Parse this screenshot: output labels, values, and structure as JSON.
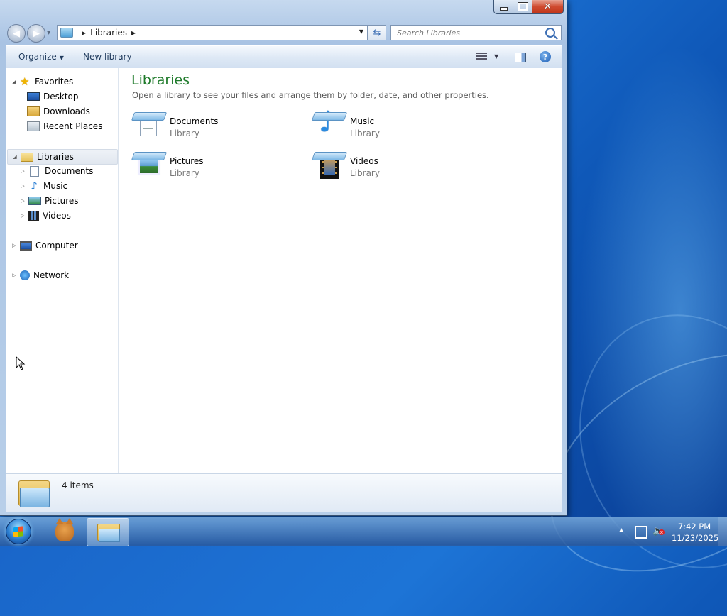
{
  "window": {
    "controls": {
      "minimize": "",
      "maximize": "",
      "close": "✕"
    }
  },
  "address_bar": {
    "breadcrumbs": [
      "Libraries"
    ],
    "search_placeholder": "Search Libraries"
  },
  "toolbar": {
    "organize_label": "Organize",
    "new_library_label": "New library",
    "help_label": "?"
  },
  "nav_pane": {
    "favorites": {
      "label": "Favorites",
      "items": [
        {
          "label": "Desktop",
          "icon": "desktop-icon"
        },
        {
          "label": "Downloads",
          "icon": "downloads-icon"
        },
        {
          "label": "Recent Places",
          "icon": "recent-places-icon"
        }
      ]
    },
    "libraries": {
      "label": "Libraries",
      "selected": true,
      "items": [
        {
          "label": "Documents",
          "icon": "documents-icon"
        },
        {
          "label": "Music",
          "icon": "music-icon"
        },
        {
          "label": "Pictures",
          "icon": "pictures-icon"
        },
        {
          "label": "Videos",
          "icon": "videos-icon"
        }
      ]
    },
    "computer": {
      "label": "Computer"
    },
    "network": {
      "label": "Network"
    }
  },
  "content": {
    "title": "Libraries",
    "subtitle": "Open a library to see your files and arrange them by folder, date, and other properties.",
    "libraries": [
      {
        "name": "Documents",
        "type": "Library",
        "icon": "documents-library-icon"
      },
      {
        "name": "Music",
        "type": "Library",
        "icon": "music-library-icon"
      },
      {
        "name": "Pictures",
        "type": "Library",
        "icon": "pictures-library-icon"
      },
      {
        "name": "Videos",
        "type": "Library",
        "icon": "videos-library-icon"
      }
    ]
  },
  "status_bar": {
    "item_count": "4 items"
  },
  "taskbar": {
    "clock_time": "7:42 PM",
    "clock_date": "11/23/2025"
  },
  "colors": {
    "title_green": "#1e7a2a",
    "toolbar_text": "#1e395b",
    "desktop_blue": "#1d74d6"
  }
}
